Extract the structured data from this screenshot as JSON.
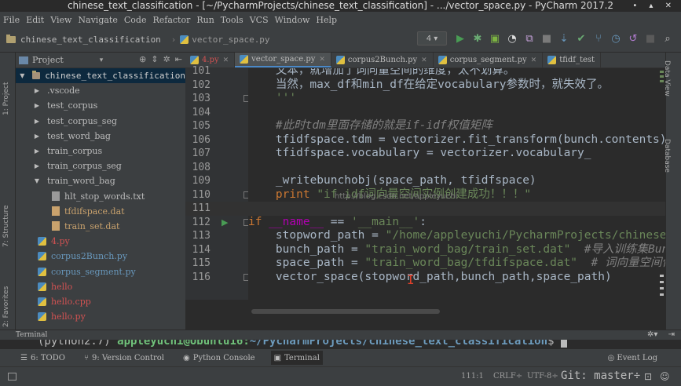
{
  "window": {
    "title": "chinese_text_classification - [~/PycharmProjects/chinese_text_classification] - .../vector_space.py - PyCharm 2017.2",
    "controls": "• ▴ ✕"
  },
  "menu": [
    "File",
    "Edit",
    "View",
    "Navigate",
    "Code",
    "Refactor",
    "Run",
    "Tools",
    "VCS",
    "Window",
    "Help"
  ],
  "breadcrumb": {
    "project": "chinese_text_classification",
    "file": "vector_space.py"
  },
  "toolbar": {
    "run_config": "4 ▾"
  },
  "left_strip": {
    "project_tab": "1: Project",
    "structure_tab": "7: Structure",
    "favorites_tab": "2: Favorites"
  },
  "right_strip": {
    "data_view_tab": "Data View",
    "database_tab": "Database"
  },
  "project_panel": {
    "label": "Project",
    "tree": [
      {
        "name": "chinese_text_classification",
        "depth": 0,
        "kind": "root",
        "expanded": true
      },
      {
        "name": ".vscode",
        "depth": 1,
        "kind": "folder"
      },
      {
        "name": "test_corpus",
        "depth": 1,
        "kind": "folder"
      },
      {
        "name": "test_corpus_seg",
        "depth": 1,
        "kind": "folder"
      },
      {
        "name": "test_word_bag",
        "depth": 1,
        "kind": "folder"
      },
      {
        "name": "train_corpus",
        "depth": 1,
        "kind": "folder"
      },
      {
        "name": "train_corpus_seg",
        "depth": 1,
        "kind": "folder"
      },
      {
        "name": "train_word_bag",
        "depth": 1,
        "kind": "folder",
        "expanded": true
      },
      {
        "name": "hlt_stop_words.txt",
        "depth": 2,
        "kind": "txt"
      },
      {
        "name": "tfdifspace.dat",
        "depth": 2,
        "kind": "dat"
      },
      {
        "name": "train_set.dat",
        "depth": 2,
        "kind": "dat"
      },
      {
        "name": "4.py",
        "depth": 1,
        "kind": "red"
      },
      {
        "name": "corpus2Bunch.py",
        "depth": 1,
        "kind": "py"
      },
      {
        "name": "corpus_segment.py",
        "depth": 1,
        "kind": "py"
      },
      {
        "name": "hello",
        "depth": 1,
        "kind": "red"
      },
      {
        "name": "hello.cpp",
        "depth": 1,
        "kind": "red"
      },
      {
        "name": "hello.py",
        "depth": 1,
        "kind": "red"
      }
    ]
  },
  "editor_tabs": [
    {
      "label": "4.py",
      "active": false,
      "red": true
    },
    {
      "label": "vector_space.py",
      "active": true,
      "red": false
    },
    {
      "label": "corpus2Bunch.py",
      "active": false,
      "red": false
    },
    {
      "label": "corpus_segment.py",
      "active": false,
      "red": false
    },
    {
      "label": "tfidf_test",
      "active": false,
      "red": false
    }
  ],
  "editor": {
    "watermark": "http://blog.csdn.net/appleyuchi",
    "lines": [
      {
        "n": "101",
        "text": "    文本，就增加了词向量空间的维度，太不划算。"
      },
      {
        "n": "102",
        "text": "    当然，max_df和min_df在给定vocabulary参数时，就失效了。"
      },
      {
        "n": "103",
        "text": "    '''"
      },
      {
        "n": "104",
        "text": ""
      },
      {
        "n": "105",
        "text": "    #此时tdm里面存储的就是if-idf权值矩阵"
      },
      {
        "n": "106",
        "text": "    tfidfspace.tdm = vectorizer.fit_transform(bunch.contents)"
      },
      {
        "n": "107",
        "text": "    tfidfspace.vocabulary = vectorizer.vocabulary_"
      },
      {
        "n": "108",
        "text": ""
      },
      {
        "n": "109",
        "text": "    _writebunchobj(space_path, tfidfspace)"
      },
      {
        "n": "110",
        "text": "    print \"if-idf词向量空间实例创建成功！！！\""
      },
      {
        "n": "111",
        "text": ""
      },
      {
        "n": "112",
        "text": "if __name__ == '__main__':"
      },
      {
        "n": "113",
        "text": "    stopword_path = \"/home/appleyuchi/PycharmProjects/chinese_"
      },
      {
        "n": "114",
        "text": "    bunch_path = \"train_word_bag/train_set.dat\"  #导入训练集Bunch"
      },
      {
        "n": "115",
        "text": "    space_path = \"train_word_bag/tfdifspace.dat\"  # 词向量空间保"
      },
      {
        "n": "116",
        "text": "    vector_space(stopword_path,bunch_path,space_path)"
      }
    ]
  },
  "terminal": {
    "label": "Terminal",
    "prompt_env": "(python2.7) ",
    "prompt_user": "appleyuchi@Ubuntu16",
    "prompt_sep": ":",
    "prompt_path": "~/PycharmProjects/chinese_text_classification",
    "prompt_end": "$ "
  },
  "bottom_tabs": [
    {
      "icon": "todo-icon",
      "glyph": "☰",
      "label": "6: TODO",
      "active": false
    },
    {
      "icon": "vcs-icon",
      "glyph": "⑂",
      "label": "9: Version Control",
      "active": false
    },
    {
      "icon": "python-console-icon",
      "glyph": "◉",
      "label": "Python Console",
      "active": false
    },
    {
      "icon": "terminal-icon",
      "glyph": "▣",
      "label": "Terminal",
      "active": true
    }
  ],
  "event_log": "Event Log",
  "status": {
    "position": "111:1",
    "line_sep": "CRLF÷",
    "encoding": "UTF-8÷",
    "git": "Git: master÷"
  },
  "colors": {
    "background": "#2b2b2b",
    "panel": "#3c3f41",
    "keyword": "#cc7832",
    "string": "#6a8759",
    "comment": "#808080",
    "dunder": "#b200b2",
    "selection": "#0d293e",
    "modified_file": "#d25252"
  }
}
